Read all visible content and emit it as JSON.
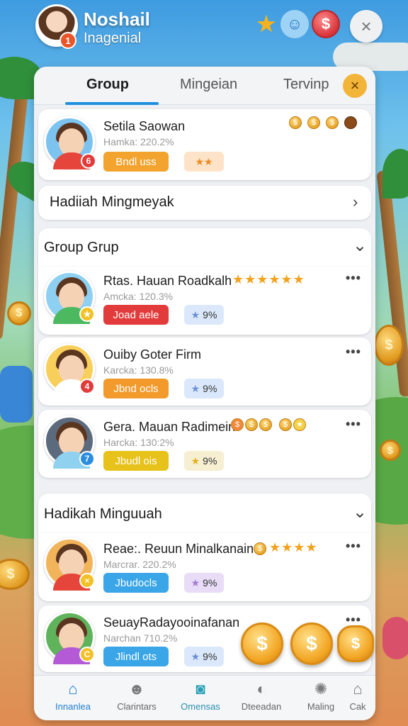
{
  "header": {
    "username": "Noshail",
    "subtitle": "Inagenial",
    "level": "1",
    "close_icon": "×",
    "icons": [
      "star-trophy-icon",
      "bunny-mascot-icon",
      "coin-currency-icon"
    ]
  },
  "tabs": [
    {
      "label": "Group",
      "active": true
    },
    {
      "label": "Mingeian",
      "active": false
    },
    {
      "label": "Tervinp",
      "active": false
    }
  ],
  "tab_close": "×",
  "profile_card": {
    "name": "Setila Saowan",
    "sub": "Hamka: 220.2%",
    "badge": "6",
    "button": "Bndl uss",
    "stars": "★★"
  },
  "banner": {
    "label": "Hadiiah Mingmeyak",
    "chevron": "›"
  },
  "group_section": {
    "title": "Group Grup",
    "chevron": "⌄",
    "rows": [
      {
        "name": "Rtas. Hauan Roadkalh",
        "sub": "Amcka: 120.3%",
        "button": "Joad aele",
        "pct": "9%",
        "badge": "★",
        "stars": "★★★★★★"
      },
      {
        "name": "Ouiby Goter Firm",
        "sub": "Karcka: 130.8%",
        "button": "Jbnd ocls",
        "pct": "9%",
        "badge": "4",
        "stars": ""
      },
      {
        "name": "Gera. Mauan Radimein",
        "sub": "Harcka: 130:2%",
        "button": "Jbudl ois",
        "pct": "9%",
        "badge": "7",
        "stars": ""
      }
    ]
  },
  "weekly_section": {
    "title": "Hadikah Minguuah",
    "chevron": "⌄",
    "rows": [
      {
        "name": "Reae:. Reuun Minalkanain",
        "sub": "Marcrar. 220.2%",
        "button": "Jbudocls",
        "pct": "9%",
        "badge": "×",
        "stars": "★★★★"
      },
      {
        "name": "SeuayRadayooinafanan",
        "sub": "Narchan 710.2%",
        "button": "Jlindl ots",
        "pct": "9%",
        "badge": "C",
        "stars": ""
      }
    ]
  },
  "more": "•••",
  "coin_symbol": "$",
  "bottom_nav": [
    {
      "label": "Innanlea",
      "icon": "home-icon",
      "active": true
    },
    {
      "label": "Clarintars",
      "icon": "robot-face-icon",
      "active": false
    },
    {
      "label": "Omensas",
      "icon": "chat-bubble-icon",
      "active": false
    },
    {
      "label": "Dteeadan",
      "icon": "lock-icon",
      "active": false
    },
    {
      "label": "Maling",
      "icon": "dots-circle-icon",
      "active": false
    },
    {
      "label": "Cak",
      "icon": "home-outline-icon",
      "active": false
    }
  ],
  "colors": {
    "accent": "#1f8fe0",
    "button_orange": "#f39a2c",
    "button_red": "#e23b3b",
    "button_yellow": "#e6c21a",
    "button_blue": "#3aa6e8"
  }
}
